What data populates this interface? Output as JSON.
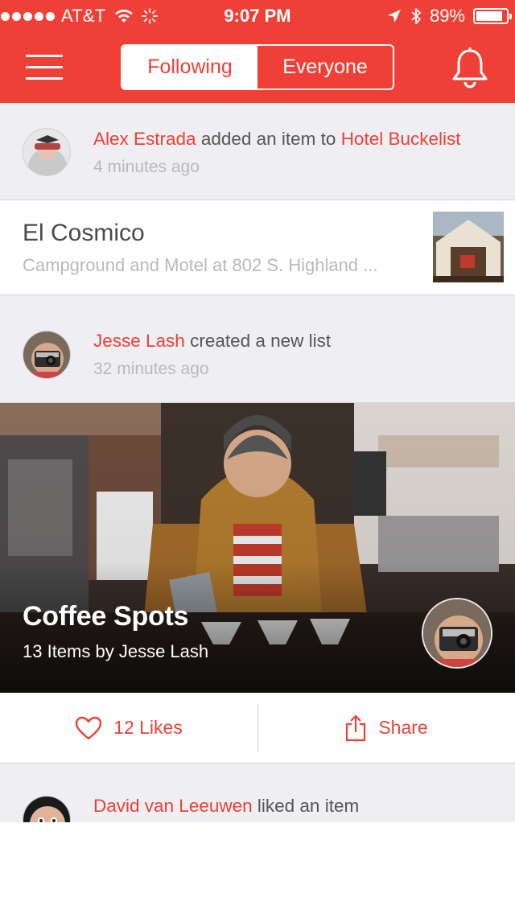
{
  "status_bar": {
    "carrier": "AT&T",
    "time": "9:07 PM",
    "battery": "89%",
    "battery_level": 0.89,
    "icons": [
      "signal-dots-icon",
      "wifi-icon",
      "activity-spinner-icon",
      "location-arrow-icon",
      "bluetooth-icon",
      "battery-icon"
    ]
  },
  "nav": {
    "menu_icon": "hamburger-menu-icon",
    "tabs": [
      {
        "label": "Following",
        "active": true
      },
      {
        "label": "Everyone",
        "active": false
      }
    ],
    "bell_icon": "bell-icon"
  },
  "colors": {
    "brand_red": "#EE4036",
    "feed_bg": "#EFEEF2",
    "muted_text": "#B9B9BD"
  },
  "feed": {
    "activity1": {
      "actor": "Alex Estrada",
      "verb": " added an item to ",
      "target": "Hotel Buckelist",
      "time_ago": "4 minutes ago"
    },
    "item1": {
      "title": "El Cosmico",
      "subtitle": "Campground and Motel at 802 S. Highland ..."
    },
    "activity2": {
      "actor": "Jesse Lash",
      "verb": " created a new list",
      "time_ago": "32 minutes ago"
    },
    "list_card": {
      "title": "Coffee Spots",
      "subtitle": "13 Items by Jesse Lash"
    },
    "actions": {
      "likes_label": "12 Likes",
      "likes_icon": "heart-icon",
      "share_label": "Share",
      "share_icon": "share-icon"
    },
    "activity3": {
      "actor": "David van Leeuwen",
      "verb": " liked an item"
    }
  }
}
